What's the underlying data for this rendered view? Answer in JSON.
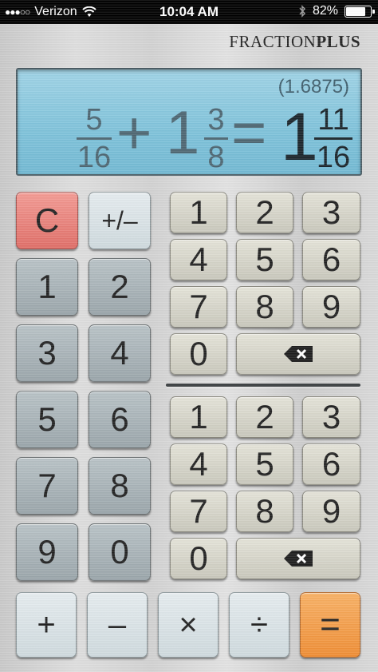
{
  "status": {
    "carrier": "Verizon",
    "signal_dots": "●●●○○",
    "time": "10:04 AM",
    "battery_percent": "82%",
    "battery_level": 0.82,
    "icons": [
      "wifi-icon",
      "bluetooth-icon",
      "battery-icon"
    ]
  },
  "brand": {
    "part1": "FRACTION",
    "part2": "PLUS"
  },
  "display": {
    "decimal": "(1.6875)",
    "operand1": {
      "num": "5",
      "den": "16"
    },
    "operator": "+",
    "operand2": {
      "whole": "1",
      "num": "3",
      "den": "8"
    },
    "equals": "=",
    "result": {
      "whole": "1",
      "num": "11",
      "den": "16"
    }
  },
  "keys": {
    "clear": "C",
    "sign": "+/–",
    "whole_digits": [
      "1",
      "2",
      "3",
      "4",
      "5",
      "6",
      "7",
      "8",
      "9",
      "0"
    ],
    "numerator_digits": [
      "1",
      "2",
      "3",
      "4",
      "5",
      "6",
      "7",
      "8",
      "9",
      "0"
    ],
    "denominator_digits": [
      "1",
      "2",
      "3",
      "4",
      "5",
      "6",
      "7",
      "8",
      "9",
      "0"
    ],
    "plus": "+",
    "minus": "–",
    "times": "×",
    "divide": "÷",
    "equals": "="
  },
  "colors": {
    "clear_key": "#e06e67",
    "equals_key": "#ef8d34",
    "display_bg": "#7ec2da"
  }
}
